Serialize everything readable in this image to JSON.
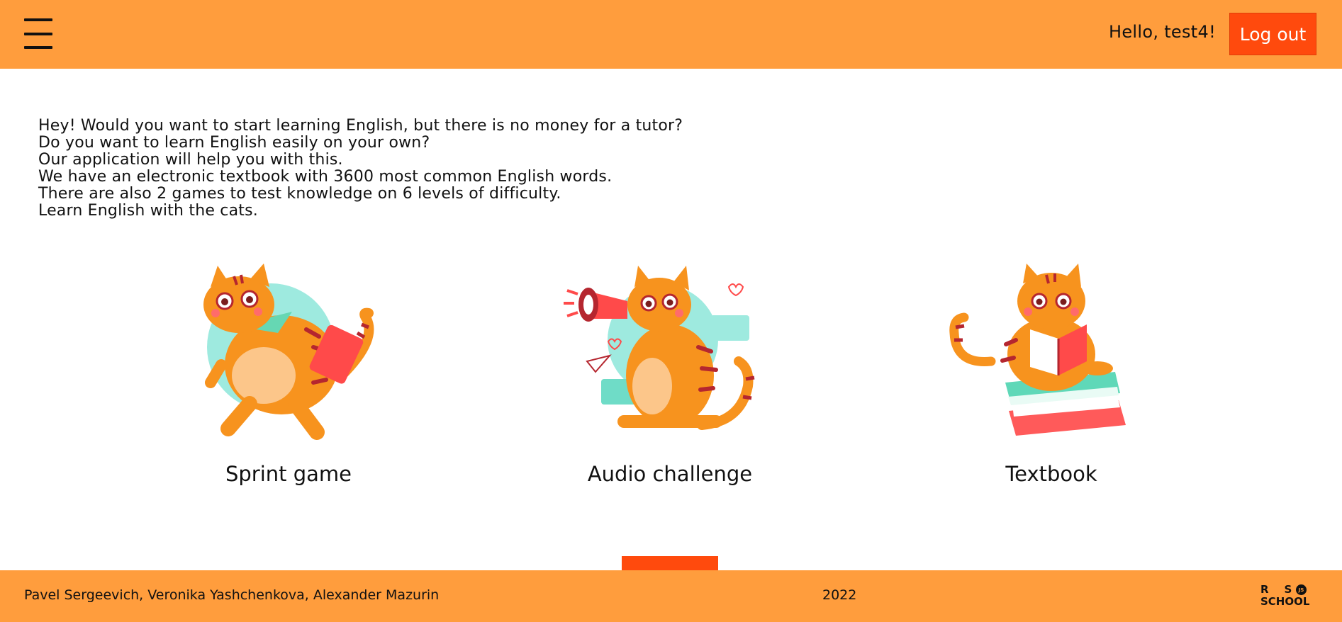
{
  "header": {
    "greeting": "Hello, test4!",
    "logout_label": "Log out",
    "menu_icon": "hamburger-menu-icon"
  },
  "intro": {
    "lines": [
      "Hey! Would you want to start learning English, but there is no money for a tutor?",
      "Do you want to learn English easily on your own?",
      "Our application will help you with this.",
      "We have an electronic textbook with 3600 most common English words.",
      "There are also 2 games to test knowledge on 6 levels of difficulty.",
      "Learn English with the cats."
    ]
  },
  "cards": [
    {
      "label": "Sprint game",
      "icon": "cat-running-with-briefcase-icon"
    },
    {
      "label": "Audio challenge",
      "icon": "cat-with-megaphone-icon"
    },
    {
      "label": "Textbook",
      "icon": "cat-reading-book-icon"
    }
  ],
  "footer": {
    "authors": "Pavel Sergeevich, Veronika Yashchenkova, Alexander Mazurin",
    "year": "2022",
    "logo_text_top": "RS",
    "logo_text_bottom": "SCHOOL",
    "logo_badge": "JS"
  },
  "colors": {
    "header_bg": "#ff9d3d",
    "accent": "#ff4a0d",
    "cat_orange": "#f7931e",
    "stripe": "#b5262f",
    "teal": "#9eeadf"
  }
}
